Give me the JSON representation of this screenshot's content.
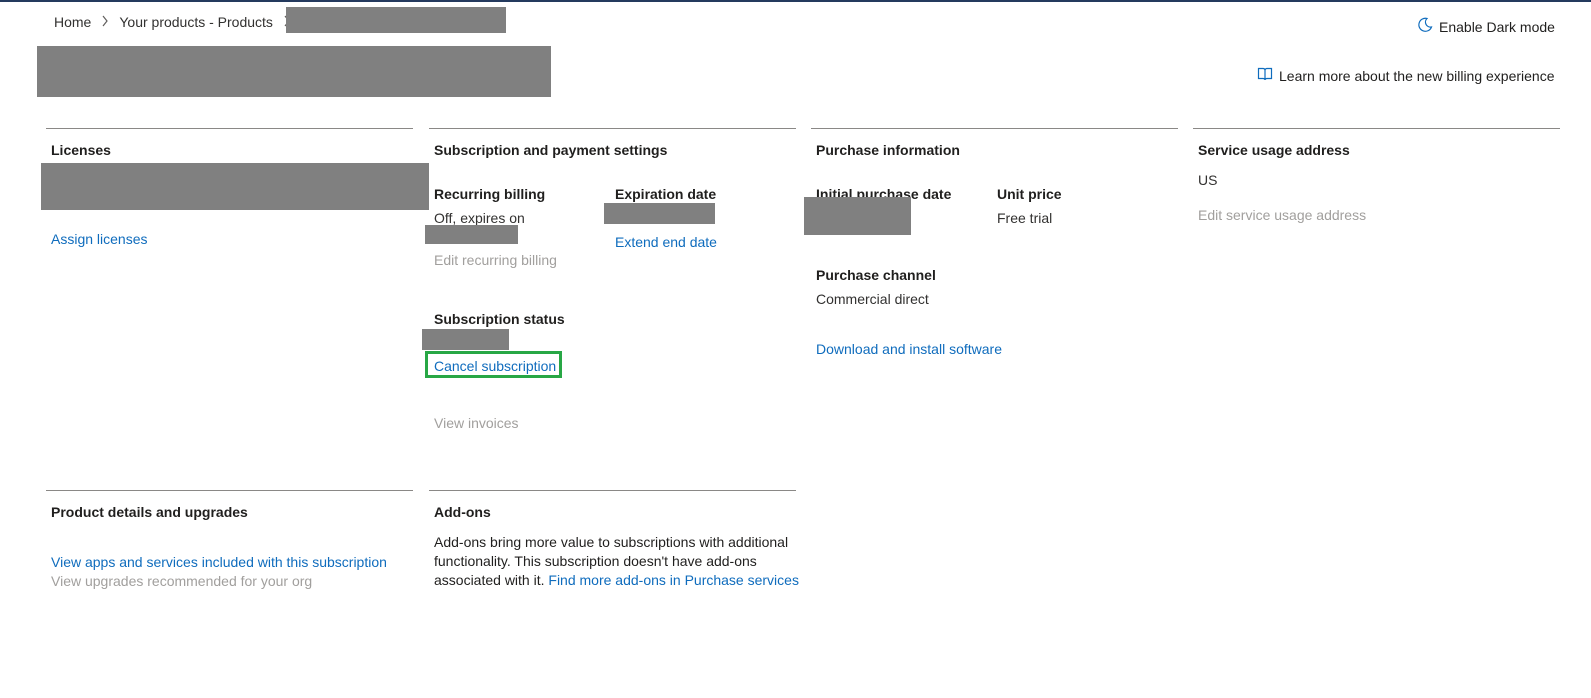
{
  "breadcrumb": {
    "home": "Home",
    "products": "Your products - Products"
  },
  "header": {
    "dark_mode": "Enable Dark mode",
    "learn_more": "Learn more about the new billing experience"
  },
  "licenses": {
    "heading": "Licenses",
    "assign": "Assign licenses"
  },
  "subscription": {
    "heading": "Subscription and payment settings",
    "recurring_label": "Recurring billing",
    "recurring_value": "Off, expires on",
    "edit_recurring": "Edit recurring billing",
    "expiration_label": "Expiration date",
    "extend": "Extend end date",
    "status_label": "Subscription status",
    "cancel": "Cancel subscription",
    "invoices": "View invoices"
  },
  "purchase": {
    "heading": "Purchase information",
    "initial_date_label": "Initial purchase date",
    "unit_price_label": "Unit price",
    "unit_price_value": "Free trial",
    "channel_label": "Purchase channel",
    "channel_value": "Commercial direct",
    "download": "Download and install software"
  },
  "service_address": {
    "heading": "Service usage address",
    "value": "US",
    "edit": "Edit service usage address"
  },
  "product_details": {
    "heading": "Product details and upgrades",
    "apps": "View apps and services included with this subscription",
    "upgrades": "View upgrades recommended for your org"
  },
  "addons": {
    "heading": "Add-ons",
    "description": "Add-ons bring more value to subscriptions with additional functionality. This subscription doesn't have add-ons associated with it.",
    "link": "Find more add-ons in Purchase services"
  },
  "colors": {
    "link": "#0f6cbd",
    "disabled": "#a19f9d",
    "highlight": "#28a745",
    "redacted": "#808080"
  }
}
